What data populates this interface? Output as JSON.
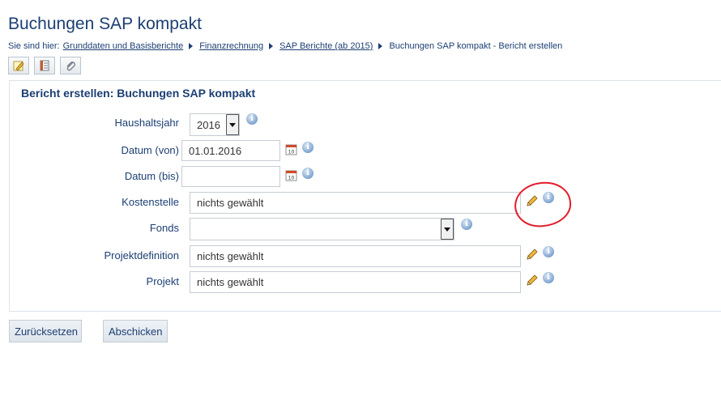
{
  "page": {
    "title": "Buchungen SAP kompakt"
  },
  "breadcrumb": {
    "prefix": "Sie sind hier:",
    "links": [
      "Grunddaten und Basisberichte",
      "Finanzrechnung",
      "SAP Berichte (ab 2015)"
    ],
    "current": "Buchungen SAP kompakt - Bericht erstellen"
  },
  "toolbar": {
    "icons": [
      "edit-note-icon",
      "document-list-icon",
      "attachment-icon"
    ]
  },
  "form": {
    "title": "Bericht erstellen: Buchungen SAP kompakt",
    "haushaltsjahr": {
      "label": "Haushaltsjahr",
      "value": "2016"
    },
    "datum_von": {
      "label": "Datum (von)",
      "value": "01.01.2016"
    },
    "datum_bis": {
      "label": "Datum (bis)",
      "value": ""
    },
    "kostenstelle": {
      "label": "Kostenstelle",
      "value": "nichts gewählt"
    },
    "fonds": {
      "label": "Fonds",
      "value": ""
    },
    "projektdefinition": {
      "label": "Projektdefinition",
      "value": "nichts gewählt"
    },
    "projekt": {
      "label": "Projekt",
      "value": "nichts gewählt"
    },
    "info_glyph": "i"
  },
  "buttons": {
    "reset": "Zurücksetzen",
    "submit": "Abschicken"
  },
  "colors": {
    "title_blue": "#1c3f73",
    "annotation_red": "#e11d2a"
  }
}
